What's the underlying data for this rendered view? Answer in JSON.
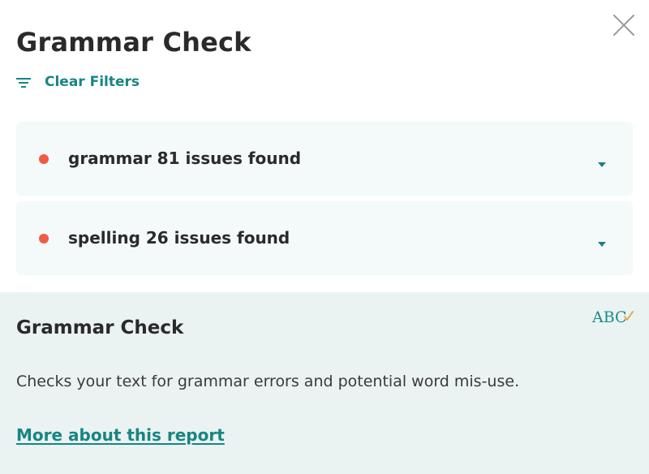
{
  "header": {
    "title": "Grammar Check",
    "close_icon": "close-icon"
  },
  "filters": {
    "icon": "filter-icon",
    "label": "Clear Filters"
  },
  "issue_groups": [
    {
      "category": "grammar",
      "summary": "grammar 81 issues found",
      "count": 81,
      "status_color": "#ef5b45",
      "expand_icon": "chevron-down-icon"
    },
    {
      "category": "spelling",
      "summary": "spelling 26 issues found",
      "count": 26,
      "status_color": "#ef5b45",
      "expand_icon": "chevron-down-icon"
    }
  ],
  "info": {
    "icon": "abc-check-icon",
    "title": "Grammar Check",
    "description": "Checks your text for grammar errors and potential word mis-use.",
    "link_label": "More about this report"
  },
  "colors": {
    "accent": "#178584",
    "error_dot": "#ef5b45",
    "card_bg": "#f4f9f9",
    "info_bg": "#eaf3f2"
  }
}
